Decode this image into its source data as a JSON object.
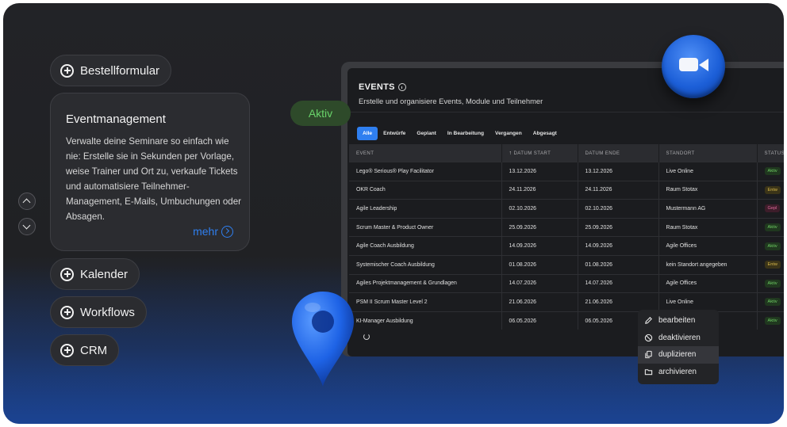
{
  "features": {
    "bestellformular": "Bestellformular",
    "eventmanagement_title": "Eventmanagement",
    "eventmanagement_text": "Verwalte deine Seminare so einfach wie nie: Erstelle sie in Sekunden per Vorlage, weise Trainer und Ort zu, verkaufe Tickets und automatisiere Teilnehmer-Management, E-Mails, Umbuchungen oder Absagen.",
    "mehr": "mehr",
    "kalender": "Kalender",
    "workflows": "Workflows",
    "crm": "CRM"
  },
  "status_pill": "Aktiv",
  "events": {
    "title": "EVENTS",
    "subtitle": "Erstelle und organisiere Events, Module und Teilnehmer",
    "tabs": [
      "Alle",
      "Entwürfe",
      "Geplant",
      "In Bearbeitung",
      "Vergangen",
      "Abgesagt"
    ],
    "columns": [
      "EVENT",
      "DATUM START",
      "DATUM ENDE",
      "STANDORT",
      "STATUS"
    ],
    "rows": [
      {
        "event": "Lego® Serious® Play Facilitator",
        "start": "13.12.2026",
        "end": "13.12.2026",
        "ort": "Live Online",
        "status": "Aktiv",
        "color": "green"
      },
      {
        "event": "OKR Coach",
        "start": "24.11.2026",
        "end": "24.11.2026",
        "ort": "Raum Stotax",
        "status": "Entw",
        "color": "yellow"
      },
      {
        "event": "Agile Leadership",
        "start": "02.10.2026",
        "end": "02.10.2026",
        "ort": "Mustermann AG",
        "status": "Gepl",
        "color": "pink"
      },
      {
        "event": "Scrum Master & Product Owner",
        "start": "25.09.2026",
        "end": "25.09.2026",
        "ort": "Raum Stotax",
        "status": "Aktiv",
        "color": "green"
      },
      {
        "event": "Agile Coach Ausbildung",
        "start": "14.09.2026",
        "end": "14.09.2026",
        "ort": "Agile Offices",
        "status": "Aktiv",
        "color": "green"
      },
      {
        "event": "Systemischer Coach Ausbildung",
        "start": "01.08.2026",
        "end": "01.08.2026",
        "ort": "kein Standort angegeben",
        "status": "Entw",
        "color": "yellow"
      },
      {
        "event": "Agiles Projektmanagement & Grundlagen",
        "start": "14.07.2026",
        "end": "14.07.2026",
        "ort": "Agile Offices",
        "status": "Aktiv",
        "color": "green"
      },
      {
        "event": "PSM II Scrum Master Level 2",
        "start": "21.06.2026",
        "end": "21.06.2026",
        "ort": "Live Online",
        "status": "Aktiv",
        "color": "green"
      },
      {
        "event": "KI-Manager Ausbildung",
        "start": "06.05.2026",
        "end": "06.05.2026",
        "ort": "",
        "status": "Aktiv",
        "color": "green"
      }
    ]
  },
  "context_menu": {
    "items": [
      {
        "label": "bearbeiten",
        "icon": "pencil-icon"
      },
      {
        "label": "deaktivieren",
        "icon": "block-icon"
      },
      {
        "label": "duplizieren",
        "icon": "copy-icon"
      },
      {
        "label": "archivieren",
        "icon": "folder-icon"
      }
    ],
    "highlighted": 2
  },
  "colors": {
    "accent": "#2f7ff0",
    "active_green": "#69d36a"
  }
}
